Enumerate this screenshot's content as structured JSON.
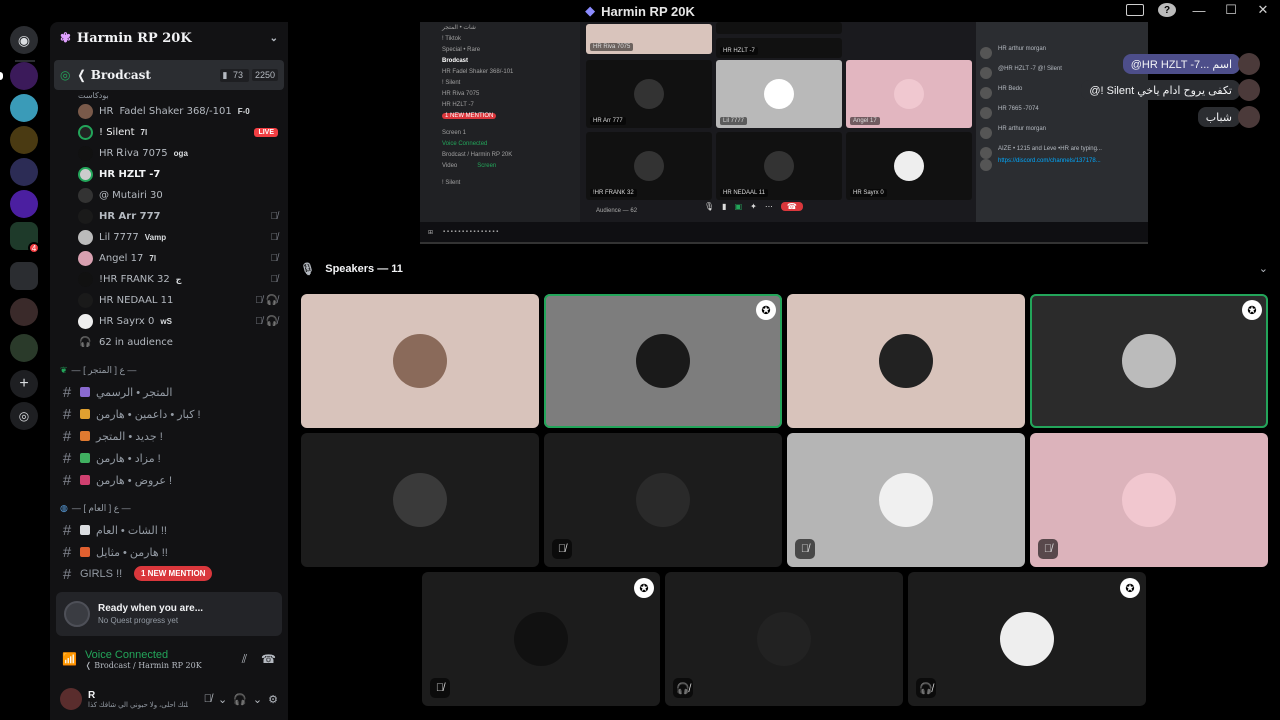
{
  "window": {
    "title": "Harmin RP 20K"
  },
  "server": {
    "name": "Harmin RP 20K"
  },
  "voice_channel": {
    "name": "Brodcast",
    "subtitle": "بودكاست",
    "count_a": "73",
    "count_b": "2250",
    "members": [
      {
        "name": "HR",
        "tag": "Fadel Shaker 368/-101",
        "badge": "F-0",
        "icons": ""
      },
      {
        "name": "! Silent",
        "tag": "",
        "badge": "7l",
        "live": "LIVE"
      },
      {
        "name": "HR Ꭱiva 7075",
        "tag": "",
        "badge": "oga",
        "icons": ""
      },
      {
        "name": "HR HZLT -7",
        "tag": "",
        "badge": "",
        "icons": ""
      },
      {
        "name": "@ Mutairi 30",
        "tag": "",
        "badge": "",
        "icons": ""
      },
      {
        "name": "HR Arr 777",
        "tag": "",
        "badge": "",
        "icons": "muted"
      },
      {
        "name": "Lil 7777",
        "tag": "",
        "badge": "Vamp",
        "icons": "muted"
      },
      {
        "name": "Angel 17",
        "tag": "",
        "badge": "7l",
        "icons": "muted"
      },
      {
        "name": "!HR FRANK 32",
        "tag": "",
        "badge": "ج",
        "icons": "muted"
      },
      {
        "name": "HR NEDAAL 11",
        "tag": "",
        "badge": "",
        "icons": "muted-deaf"
      },
      {
        "name": "HR Sayrx 0",
        "tag": "",
        "badge": "wS",
        "icons": "muted-deaf"
      }
    ],
    "audience": "62 in audience"
  },
  "categories": [
    {
      "label": "— ع [ المتجر ] —",
      "channels": [
        "المتجر • الرسمي",
        "كبار • داعمين • هارمن !",
        "جديد • المتجر !",
        "مزاد • هارمن !",
        "عروض • هارمن !"
      ]
    },
    {
      "label": "— ع [ العام ] —",
      "channels": [
        "الشات • العام !!",
        "هارمن • مثايل !!",
        "GIRLS !!"
      ]
    }
  ],
  "new_mention": "1 NEW MENTION",
  "quest": {
    "title": "Ready when you are...",
    "subtitle": "No Quest progress yet"
  },
  "voice_status": {
    "title": "Voice Connected",
    "subtitle": "Brodcast / Harmin RP 20K"
  },
  "user": {
    "name": "R",
    "status": "الي خلتك احلى، ولا حبوني الي شافك كذا"
  },
  "stream": {
    "side_rows": [
      "شات • المتجر",
      "! Tiktok",
      "Special • Rare",
      "Brodcast",
      "HR Fadel Shaker 368/-101",
      "! Silent",
      "HR Riva 7075",
      "HR HZLT -7",
      "1 NEW MENTION",
      "Screen 1",
      "Voice Connected",
      "Brodcast / Harmin RP 20K",
      "Video",
      "Screen",
      "! Silent"
    ],
    "tiles": [
      "HR Riva 7075",
      "HR HZLT -7",
      "Lil 7777",
      "Angel 17",
      "HR Arr 777",
      "!HR FRANK 32",
      "HR NEDAAL 11",
      "HR Sayrx 0"
    ],
    "audience": "Audience — 62",
    "chat": [
      "HR arthur morgan",
      "@HR HZLT -7 @! Silent",
      "HR Bedo",
      "HR 7665 -7074",
      "HR arthur morgan",
      "AIZE • 1215 and Leve •HR are typing..."
    ],
    "link": "https://discord.com/channels/137178..."
  },
  "overlay_messages": [
    "@HR HZLT -7... اسم",
    "@! Silent تكفى يروح ادام ياخي",
    "شباب"
  ],
  "speakers": {
    "header": "Speakers — 11"
  },
  "colors": {
    "accent_green": "#23a55a",
    "live_red": "#f23f43",
    "mention_red": "#da373c"
  }
}
